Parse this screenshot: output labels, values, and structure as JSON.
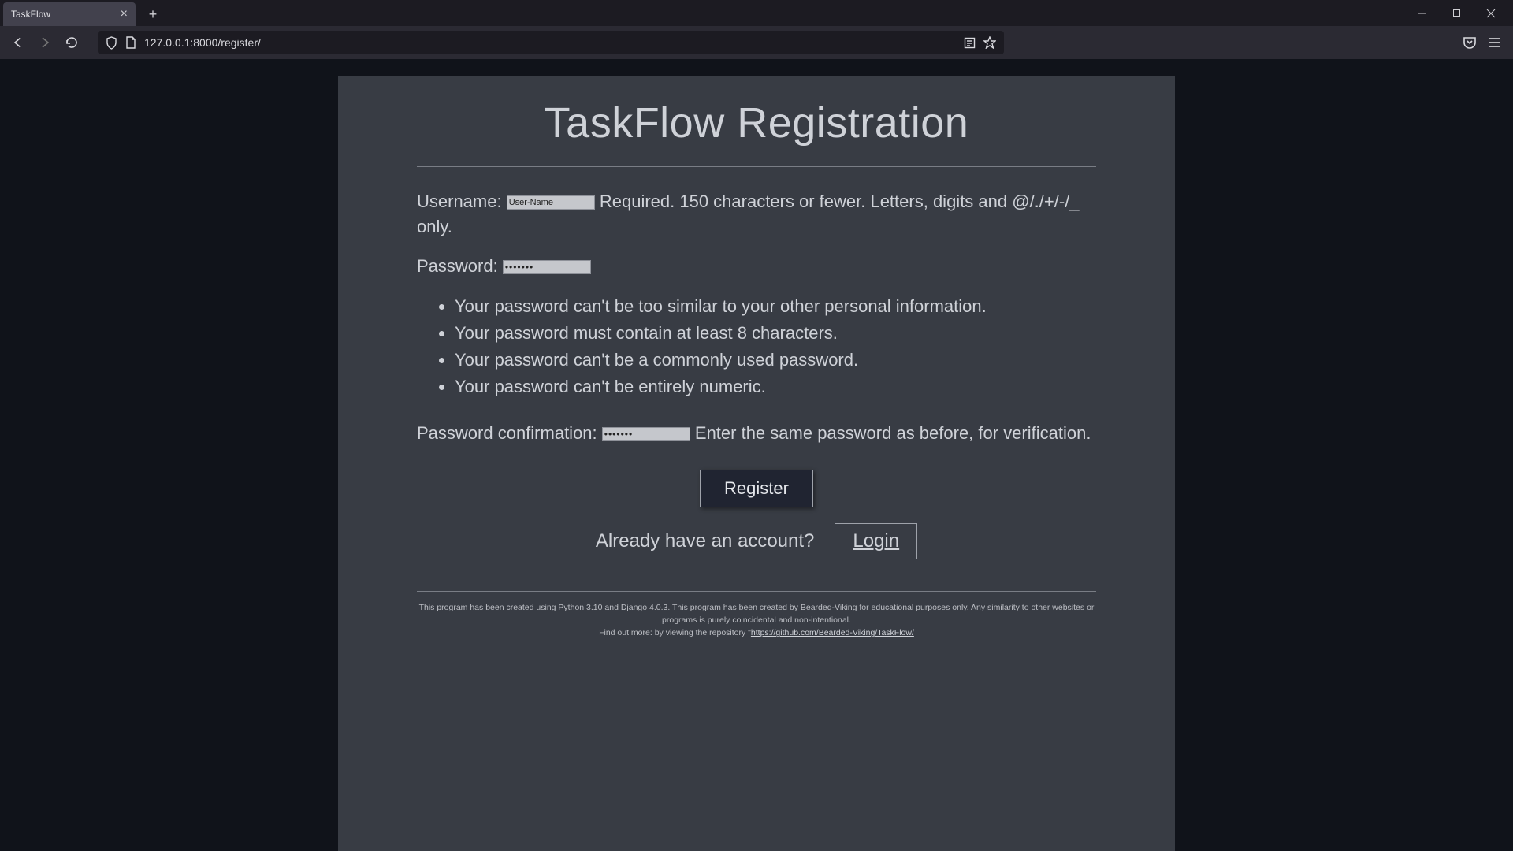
{
  "browser": {
    "tab_title": "TaskFlow",
    "url": "127.0.0.1:8000/register/"
  },
  "page": {
    "title": "TaskFlow Registration",
    "fields": {
      "username": {
        "label": "Username: ",
        "value": "User-Name",
        "help": " Required. 150 characters or fewer. Letters, digits and @/./+/-/_ only."
      },
      "password": {
        "label": "Password: ",
        "value": "•••••••",
        "rules": [
          "Your password can't be too similar to your other personal information.",
          "Your password must contain at least 8 characters.",
          "Your password can't be a commonly used password.",
          "Your password can't be entirely numeric."
        ]
      },
      "password2": {
        "label": "Password confirmation: ",
        "value": "•••••••",
        "help": " Enter the same password as before, for verification."
      }
    },
    "buttons": {
      "register": "Register",
      "login": "Login"
    },
    "login_prompt": "Already have an account?",
    "footer": {
      "line1": "This program has been created using Python 3.10 and Django 4.0.3. This program has been created by Bearded-Viking for educational purposes only. Any similarity to other websites or programs is purely coincidental and non-intentional.",
      "line2_prefix": "Find out more: by viewing the repository \"",
      "repo_url": "https://github.com/Bearded-Viking/TaskFlow/"
    }
  }
}
